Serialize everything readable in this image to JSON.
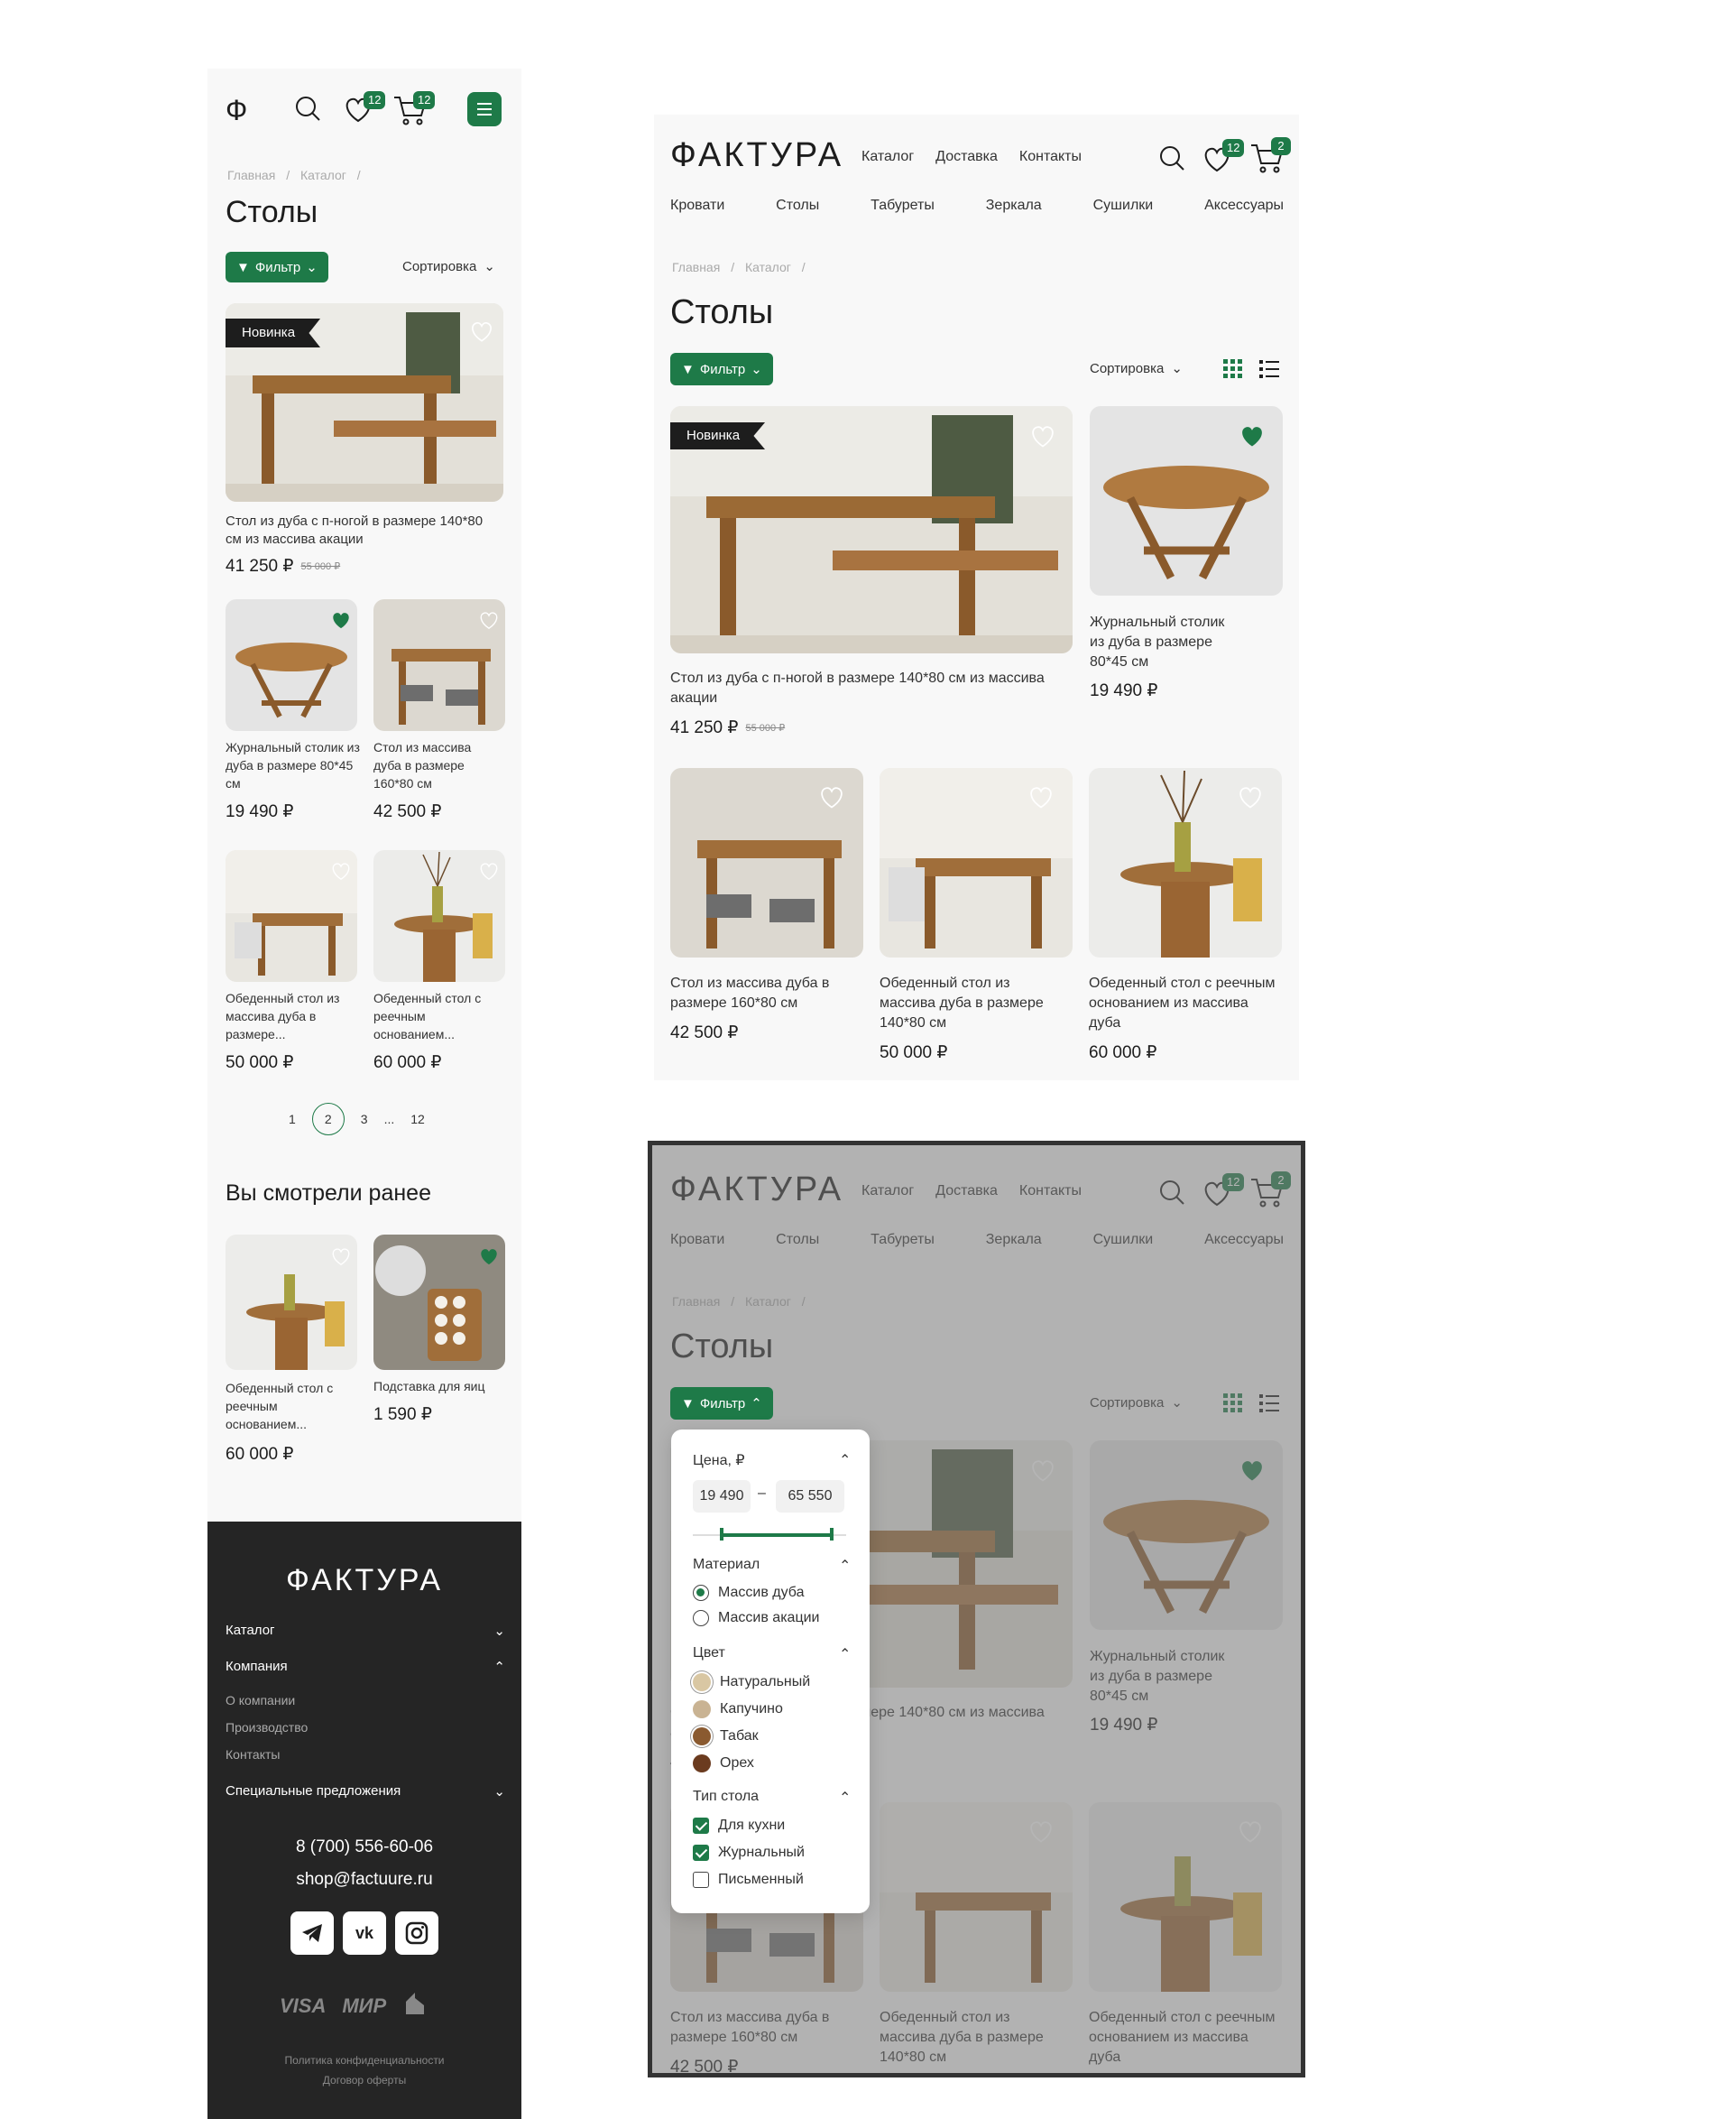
{
  "brand": "ФАКТУРА",
  "nav": {
    "catalog": "Каталог",
    "delivery": "Доставка",
    "contacts": "Контакты"
  },
  "categories": [
    "Кровати",
    "Столы",
    "Табуреты",
    "Зеркала",
    "Сушилки",
    "Аксессуары"
  ],
  "badges": {
    "favorites": "12",
    "cart_mobile": "12",
    "cart_desktop": "2"
  },
  "mobile_logo": "Ф",
  "breadcrumb": {
    "home": "Главная",
    "sep": "/",
    "catalog": "Каталог",
    "sep2": "/"
  },
  "page_title": "Столы",
  "filter_label": "Фильтр",
  "sort_label": "Сортировка",
  "new_tag": "Новинка",
  "products": [
    {
      "title": "Стол из дуба с п-ногой в размере 140*80 см из массива акации",
      "price": "41 250 ₽",
      "old_price": "55 000 ₽",
      "favorite": false
    },
    {
      "title": "Журнальный столик из дуба в размере 80*45 см",
      "price": "19 490 ₽",
      "favorite": true
    },
    {
      "title": "Стол из массива дуба в размере 160*80 см",
      "price": "42 500 ₽",
      "favorite": false
    },
    {
      "title": "Обеденный стол из массива дуба в размере 140*80 см",
      "price": "50 000 ₽",
      "favorite": false
    },
    {
      "title": "Обеденный стол с реечным основанием из массива дуба",
      "price": "60 000 ₽",
      "favorite": false
    }
  ],
  "mobile_titles": {
    "p0": "Стол из дуба с п-ногой в размере 140*80 см из массива акации",
    "p1": "Журнальный столик из дуба в размере 80*45 см",
    "p2": "Стол из массива дуба в размере 160*80 см",
    "p3": "Обеденный стол из массива дуба в размере...",
    "p4": "Обеденный стол с реечным основанием..."
  },
  "pagination": {
    "p1": "1",
    "p2": "2",
    "p3": "3",
    "dots": "...",
    "last": "12",
    "current": 2
  },
  "recent": {
    "title": "Вы смотрели ранее",
    "items": [
      {
        "title": "Обеденный стол с реечным основанием...",
        "price": "60 000 ₽",
        "favorite": false
      },
      {
        "title": "Подставка для яиц",
        "price": "1 590 ₽",
        "favorite": true
      }
    ]
  },
  "footer": {
    "logo": "ФАКТУРА",
    "catalog": "Каталог",
    "company": "Компания",
    "company_links": [
      "О компании",
      "Производство",
      "Контакты"
    ],
    "specials": "Специальные предложения",
    "phone": "8 (700) 556-60-06",
    "email": "shop@factuure.ru",
    "payments": {
      "visa": "VISA",
      "mir": "МИР"
    },
    "privacy": "Политика конфиденциальности",
    "offer": "Договор оферты"
  },
  "filter_panel": {
    "price_label": "Цена, ₽",
    "price_min": "19 490",
    "price_dash": "–",
    "price_max": "65 550",
    "material_label": "Материал",
    "materials": [
      {
        "label": "Массив дуба",
        "selected": true
      },
      {
        "label": "Массив акации",
        "selected": false
      }
    ],
    "color_label": "Цвет",
    "colors": [
      {
        "label": "Натуральный",
        "hex": "#d9c7a3"
      },
      {
        "label": "Капучино",
        "hex": "#c9b393"
      },
      {
        "label": "Табак",
        "hex": "#8a5a30"
      },
      {
        "label": "Орех",
        "hex": "#6b3b1f"
      }
    ],
    "type_label": "Тип стола",
    "types": [
      {
        "label": "Для кухни",
        "checked": true
      },
      {
        "label": "Журнальный",
        "checked": true
      },
      {
        "label": "Письменный",
        "checked": false
      }
    ]
  },
  "colors": {
    "accent": "#1e7a48",
    "dark": "#252525",
    "page": "#f8f8f8"
  }
}
